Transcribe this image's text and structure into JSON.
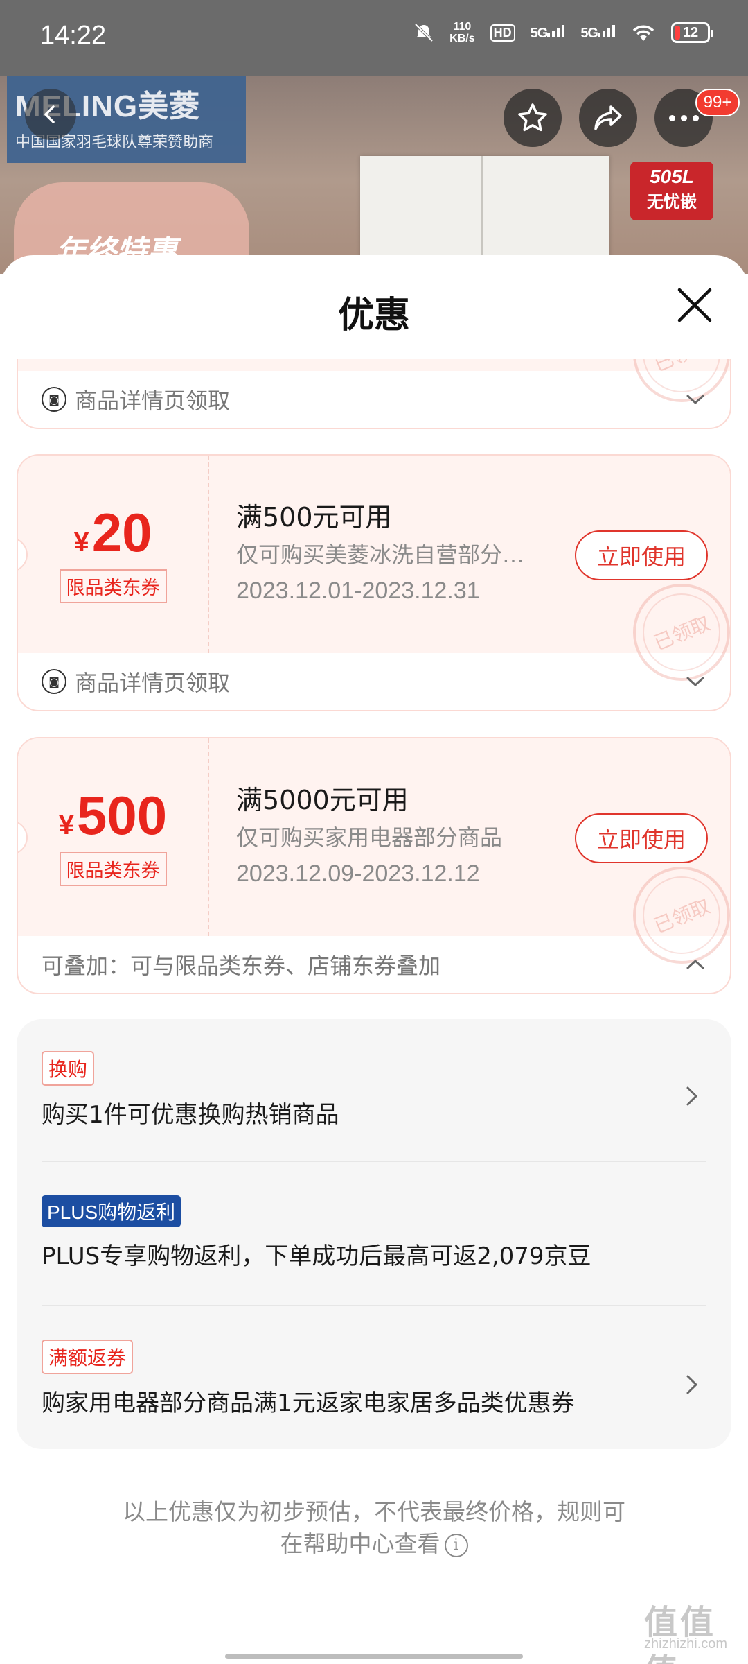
{
  "status_bar": {
    "time": "14:22",
    "net_speed_value": "110",
    "net_speed_unit": "KB/s",
    "hd_label": "HD",
    "signal1": "5G",
    "signal2": "5G",
    "battery": "12"
  },
  "hero": {
    "brand_name": "MELING美菱",
    "brand_sub": "中国国家羽毛球队尊荣赞助商",
    "sticker_top": "505L",
    "sticker_bottom": "无忧嵌",
    "promo_text": "年终特惠",
    "cart_badge": "99+",
    "icons": [
      "back-arrow-icon",
      "star-icon",
      "share-icon",
      "more-icon"
    ]
  },
  "sheet": {
    "title": "优惠"
  },
  "coupons": [
    {
      "footer": "商品详情页领取"
    },
    {
      "currency": "¥",
      "amount": "20",
      "tag": "限品类东券",
      "condition": "满500元可用",
      "scope": "仅可购买美菱冰洗自营部分商品",
      "date": "2023.12.01-2023.12.31",
      "button": "立即使用",
      "stamp": "已领取",
      "footer": "商品详情页领取"
    },
    {
      "currency": "¥",
      "amount": "500",
      "tag": "限品类东券",
      "condition": "满5000元可用",
      "scope": "仅可购买家用电器部分商品",
      "date": "2023.12.09-2023.12.12",
      "button": "立即使用",
      "stamp": "已领取",
      "footer": "可叠加：可与限品类东券、店铺东券叠加"
    }
  ],
  "promotions": [
    {
      "badge": "换购",
      "text": "购买1件可优惠换购热销商品"
    },
    {
      "badge": "PLUS购物返利",
      "text": "PLUS专享购物返利，下单成功后最高可返2,079京豆"
    },
    {
      "badge": "满额返券",
      "text": "购家用电器部分商品满1元返家电家居多品类优惠券"
    }
  ],
  "disclaimer": {
    "line1": "以上优惠仅为初步预估，不代表最终价格，规则可",
    "line2": "在帮助中心查看"
  },
  "watermark": {
    "main": "值值值",
    "sub": "zhizhizhi.com"
  },
  "colors": {
    "accent_red": "#e8251d",
    "coupon_bg": "#fff3f0",
    "plus_blue": "#1c4ea2"
  }
}
